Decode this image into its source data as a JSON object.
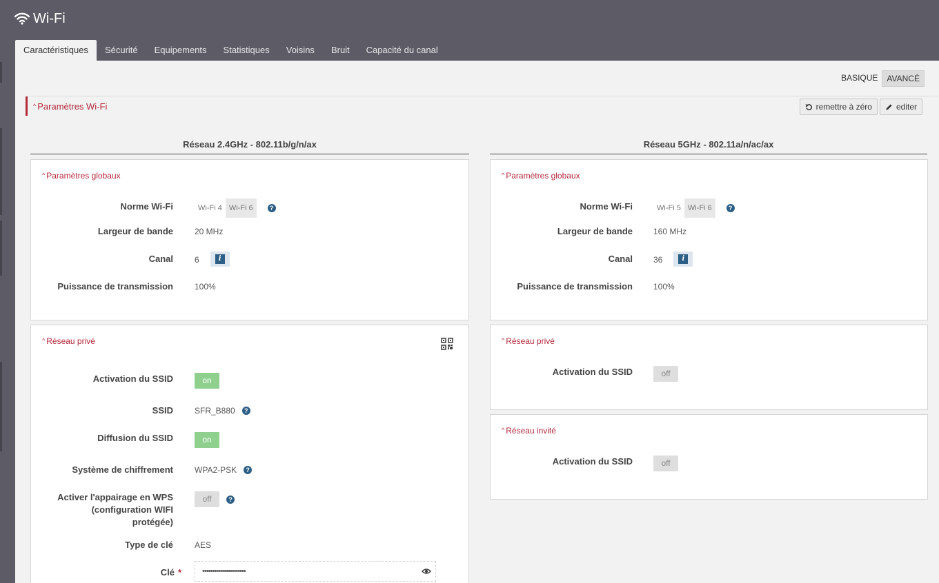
{
  "app": {
    "title": "Wi-Fi",
    "icon": "wifi-icon"
  },
  "tabs": [
    {
      "label": "Caractéristiques",
      "active": true
    },
    {
      "label": "Sécurité"
    },
    {
      "label": "Equipements"
    },
    {
      "label": "Statistiques"
    },
    {
      "label": "Voisins"
    },
    {
      "label": "Bruit"
    },
    {
      "label": "Capacité du canal"
    }
  ],
  "mode": {
    "basic": "BASIQUE",
    "advanced": "AVANCÉ",
    "selected": "AVANCÉ"
  },
  "section": {
    "title": "Paramètres Wi-Fi",
    "reset_label": "remettre à zéro",
    "edit_label": "editer"
  },
  "band24": {
    "title": "Réseau 2.4GHz - 802.11b/g/n/ax",
    "global": {
      "title": "Paramètres globaux",
      "norm_label": "Norme Wi-Fi",
      "norm_options": [
        "Wi-Fi 4",
        "Wi-Fi 6"
      ],
      "norm_selected": "Wi-Fi 6",
      "bandwidth_label": "Largeur de bande",
      "bandwidth_value": "20 MHz",
      "channel_label": "Canal",
      "channel_value": "6",
      "power_label": "Puissance de transmission",
      "power_value": "100%"
    },
    "private": {
      "title": "Réseau privé",
      "ssid_activation_label": "Activation du SSID",
      "ssid_activation_value": "on",
      "ssid_label": "SSID",
      "ssid_value": "SFR_B880",
      "broadcast_label": "Diffusion du SSID",
      "broadcast_value": "on",
      "encryption_label": "Système de chiffrement",
      "encryption_value": "WPA2-PSK",
      "wps_label_1": "Activer l'appairage en WPS",
      "wps_label_2": "(configuration WIFI",
      "wps_label_3": "protégée)",
      "wps_value": "off",
      "key_type_label": "Type de clé",
      "key_type_value": "AES",
      "key_label": "Clé",
      "key_required": "*",
      "key_value": "••••••••••••••••••••••"
    }
  },
  "band5": {
    "title": "Réseau 5GHz - 802.11a/n/ac/ax",
    "global": {
      "title": "Paramètres globaux",
      "norm_label": "Norme Wi-Fi",
      "norm_options": [
        "Wi-Fi 5",
        "Wi-Fi 6"
      ],
      "norm_selected": "Wi-Fi 6",
      "bandwidth_label": "Largeur de bande",
      "bandwidth_value": "160 MHz",
      "channel_label": "Canal",
      "channel_value": "36",
      "power_label": "Puissance de transmission",
      "power_value": "100%"
    },
    "private": {
      "title": "Réseau privé",
      "ssid_activation_label": "Activation du SSID",
      "ssid_activation_value": "off"
    },
    "guest": {
      "title": "Réseau invité",
      "ssid_activation_label": "Activation du SSID",
      "ssid_activation_value": "off"
    }
  },
  "colors": {
    "accent": "#b3293c",
    "toggle_on": "#8fd08f",
    "help": "#2d5f86"
  }
}
